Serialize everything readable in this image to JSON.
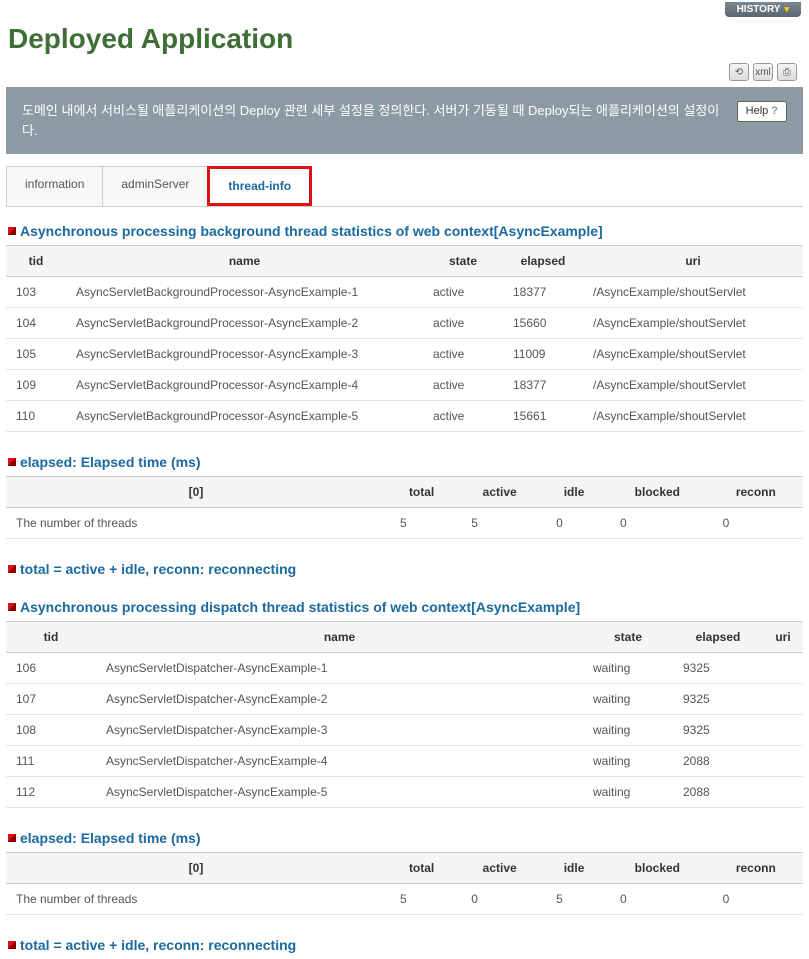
{
  "history": {
    "label": "HISTORY"
  },
  "page_title": "Deployed Application",
  "description": "도메인 내에서 서비스될 애플리케이션의 Deploy 관련 세부 설정을 정의한다. 서버가 기동될 때 Deploy되는 애플리케이션의 설정이다.",
  "help_label": "Help",
  "tabs": [
    {
      "label": "information",
      "active": false
    },
    {
      "label": "adminServer",
      "active": false
    },
    {
      "label": "thread-info",
      "active": true
    }
  ],
  "section1": {
    "title": "Asynchronous processing background thread statistics of web context[AsyncExample]",
    "headers": [
      "tid",
      "name",
      "state",
      "elapsed",
      "uri"
    ],
    "rows": [
      {
        "tid": "103",
        "name": "AsyncServletBackgroundProcessor-AsyncExample-1",
        "state": "active",
        "elapsed": "18377",
        "uri": "/AsyncExample/shoutServlet"
      },
      {
        "tid": "104",
        "name": "AsyncServletBackgroundProcessor-AsyncExample-2",
        "state": "active",
        "elapsed": "15660",
        "uri": "/AsyncExample/shoutServlet"
      },
      {
        "tid": "105",
        "name": "AsyncServletBackgroundProcessor-AsyncExample-3",
        "state": "active",
        "elapsed": "11009",
        "uri": "/AsyncExample/shoutServlet"
      },
      {
        "tid": "109",
        "name": "AsyncServletBackgroundProcessor-AsyncExample-4",
        "state": "active",
        "elapsed": "18377",
        "uri": "/AsyncExample/shoutServlet"
      },
      {
        "tid": "110",
        "name": "AsyncServletBackgroundProcessor-AsyncExample-5",
        "state": "active",
        "elapsed": "15661",
        "uri": "/AsyncExample/shoutServlet"
      }
    ]
  },
  "section2": {
    "title": "elapsed: Elapsed time (ms)",
    "headers": [
      "[0]",
      "total",
      "active",
      "idle",
      "blocked",
      "reconn"
    ],
    "row": {
      "label": "The number of threads",
      "total": "5",
      "active": "5",
      "idle": "0",
      "blocked": "0",
      "reconn": "0"
    }
  },
  "section3": {
    "title": "total = active + idle, reconn: reconnecting"
  },
  "section4": {
    "title": "Asynchronous processing dispatch thread statistics of web context[AsyncExample]",
    "headers": [
      "tid",
      "name",
      "state",
      "elapsed",
      "uri"
    ],
    "rows": [
      {
        "tid": "106",
        "name": "AsyncServletDispatcher-AsyncExample-1",
        "state": "waiting",
        "elapsed": "9325",
        "uri": ""
      },
      {
        "tid": "107",
        "name": "AsyncServletDispatcher-AsyncExample-2",
        "state": "waiting",
        "elapsed": "9325",
        "uri": ""
      },
      {
        "tid": "108",
        "name": "AsyncServletDispatcher-AsyncExample-3",
        "state": "waiting",
        "elapsed": "9325",
        "uri": ""
      },
      {
        "tid": "111",
        "name": "AsyncServletDispatcher-AsyncExample-4",
        "state": "waiting",
        "elapsed": "2088",
        "uri": ""
      },
      {
        "tid": "112",
        "name": "AsyncServletDispatcher-AsyncExample-5",
        "state": "waiting",
        "elapsed": "2088",
        "uri": ""
      }
    ]
  },
  "section5": {
    "title": "elapsed: Elapsed time (ms)",
    "headers": [
      "[0]",
      "total",
      "active",
      "idle",
      "blocked",
      "reconn"
    ],
    "row": {
      "label": "The number of threads",
      "total": "5",
      "active": "0",
      "idle": "5",
      "blocked": "0",
      "reconn": "0"
    }
  },
  "section6": {
    "title": "total = active + idle, reconn: reconnecting"
  }
}
